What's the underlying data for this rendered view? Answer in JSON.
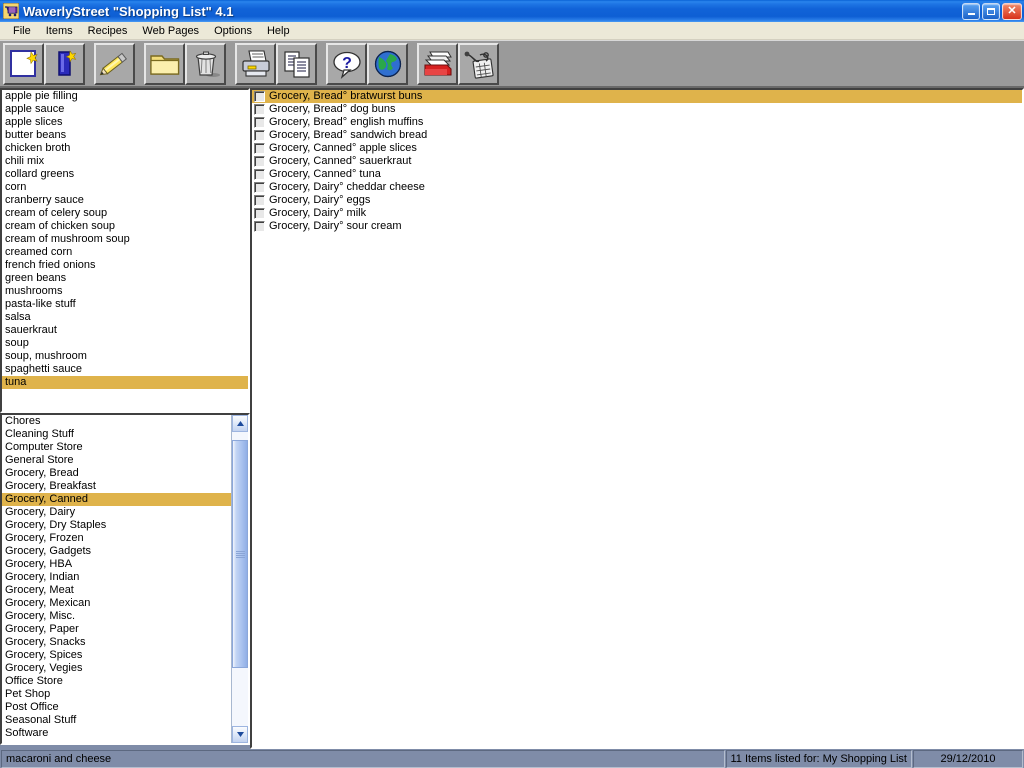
{
  "window": {
    "title": "WaverlyStreet \"Shopping List\" 4.1",
    "icon": "shopping-cart-icon",
    "buttons": {
      "minimize": "_",
      "maximize": "❐",
      "close": "✕"
    },
    "titlebar_color": "#0e5fd4"
  },
  "menubar": {
    "items": [
      {
        "label": "File"
      },
      {
        "label": "Items"
      },
      {
        "label": "Recipes"
      },
      {
        "label": "Web Pages"
      },
      {
        "label": "Options"
      },
      {
        "label": "Help"
      }
    ]
  },
  "toolbar": {
    "groups": [
      {
        "buttons": [
          {
            "name": "new-list-button",
            "icon": "new-document-icon",
            "label": "New"
          },
          {
            "name": "new-item-button",
            "icon": "new-item-icon",
            "label": "New Item"
          }
        ]
      },
      {
        "buttons": [
          {
            "name": "edit-button",
            "icon": "pencil-icon",
            "label": "Edit"
          }
        ]
      },
      {
        "buttons": [
          {
            "name": "open-button",
            "icon": "folder-icon",
            "label": "Open"
          },
          {
            "name": "delete-button",
            "icon": "trash-can-icon",
            "label": "Delete"
          }
        ]
      },
      {
        "buttons": [
          {
            "name": "print-button",
            "icon": "printer-icon",
            "label": "Print"
          },
          {
            "name": "copy-button",
            "icon": "copy-pages-icon",
            "label": "Copy"
          }
        ]
      },
      {
        "buttons": [
          {
            "name": "help-button",
            "icon": "question-balloon-icon",
            "label": "Help"
          },
          {
            "name": "web-button",
            "icon": "globe-icon",
            "label": "Web"
          }
        ]
      },
      {
        "buttons": [
          {
            "name": "recipes-button",
            "icon": "recipe-box-icon",
            "label": "Recipes"
          },
          {
            "name": "tools-button",
            "icon": "calculator-tools-icon",
            "label": "Tools"
          }
        ]
      }
    ]
  },
  "items_panel": {
    "name": "items-list",
    "items": [
      {
        "label": "apple pie filling",
        "selected": false
      },
      {
        "label": "apple sauce",
        "selected": false
      },
      {
        "label": "apple slices",
        "selected": false
      },
      {
        "label": "butter beans",
        "selected": false
      },
      {
        "label": "chicken broth",
        "selected": false
      },
      {
        "label": "chili mix",
        "selected": false
      },
      {
        "label": "collard greens",
        "selected": false
      },
      {
        "label": "corn",
        "selected": false
      },
      {
        "label": "cranberry sauce",
        "selected": false
      },
      {
        "label": "cream of celery soup",
        "selected": false
      },
      {
        "label": "cream of chicken soup",
        "selected": false
      },
      {
        "label": "cream of mushroom soup",
        "selected": false
      },
      {
        "label": "creamed corn",
        "selected": false
      },
      {
        "label": "french fried onions",
        "selected": false
      },
      {
        "label": "green beans",
        "selected": false
      },
      {
        "label": "mushrooms",
        "selected": false
      },
      {
        "label": "pasta-like stuff",
        "selected": false
      },
      {
        "label": "salsa",
        "selected": false
      },
      {
        "label": "sauerkraut",
        "selected": false
      },
      {
        "label": "soup",
        "selected": false
      },
      {
        "label": "soup, mushroom",
        "selected": false
      },
      {
        "label": "spaghetti sauce",
        "selected": false
      },
      {
        "label": "tuna",
        "selected": true
      }
    ]
  },
  "categories_panel": {
    "name": "categories-list",
    "items": [
      {
        "label": "Chores",
        "selected": false
      },
      {
        "label": "Cleaning Stuff",
        "selected": false
      },
      {
        "label": "Computer Store",
        "selected": false
      },
      {
        "label": "General Store",
        "selected": false
      },
      {
        "label": "Grocery, Bread",
        "selected": false
      },
      {
        "label": "Grocery, Breakfast",
        "selected": false
      },
      {
        "label": "Grocery, Canned",
        "selected": true
      },
      {
        "label": "Grocery, Dairy",
        "selected": false
      },
      {
        "label": "Grocery, Dry Staples",
        "selected": false
      },
      {
        "label": "Grocery, Frozen",
        "selected": false
      },
      {
        "label": "Grocery, Gadgets",
        "selected": false
      },
      {
        "label": "Grocery, HBA",
        "selected": false
      },
      {
        "label": "Grocery, Indian",
        "selected": false
      },
      {
        "label": "Grocery, Meat",
        "selected": false
      },
      {
        "label": "Grocery, Mexican",
        "selected": false
      },
      {
        "label": "Grocery, Misc.",
        "selected": false
      },
      {
        "label": "Grocery, Paper",
        "selected": false
      },
      {
        "label": "Grocery, Snacks",
        "selected": false
      },
      {
        "label": "Grocery, Spices",
        "selected": false
      },
      {
        "label": "Grocery, Vegies",
        "selected": false
      },
      {
        "label": "Office Store",
        "selected": false
      },
      {
        "label": "Pet Shop",
        "selected": false
      },
      {
        "label": "Post Office",
        "selected": false
      },
      {
        "label": "Seasonal Stuff",
        "selected": false
      },
      {
        "label": "Software",
        "selected": false
      }
    ],
    "scrollbar": {
      "name": "categories-scrollbar",
      "up": "▲",
      "down": "▼"
    }
  },
  "shopping_panel": {
    "name": "shopping-list",
    "items": [
      {
        "label": "Grocery, Bread° bratwurst buns",
        "checked": false,
        "selected": true
      },
      {
        "label": "Grocery, Bread° dog buns",
        "checked": false,
        "selected": false
      },
      {
        "label": "Grocery, Bread° english muffins",
        "checked": false,
        "selected": false
      },
      {
        "label": "Grocery, Bread° sandwich bread",
        "checked": false,
        "selected": false
      },
      {
        "label": "Grocery, Canned° apple slices",
        "checked": false,
        "selected": false
      },
      {
        "label": "Grocery, Canned° sauerkraut",
        "checked": false,
        "selected": false
      },
      {
        "label": "Grocery, Canned° tuna",
        "checked": false,
        "selected": false
      },
      {
        "label": "Grocery, Dairy° cheddar cheese",
        "checked": false,
        "selected": false
      },
      {
        "label": "Grocery, Dairy° eggs",
        "checked": false,
        "selected": false
      },
      {
        "label": "Grocery, Dairy° milk",
        "checked": false,
        "selected": false
      },
      {
        "label": "Grocery, Dairy° sour cream",
        "checked": false,
        "selected": false
      }
    ]
  },
  "statusbar": {
    "message": "macaroni and cheese",
    "count": "11 Items listed for: My Shopping List",
    "date": "29/12/2010"
  },
  "colors": {
    "selection": "#dfb34b",
    "window_bg": "#7f8ca8",
    "toolbar_bg": "#9a9a9a",
    "menubar_bg": "#ece9d8"
  }
}
